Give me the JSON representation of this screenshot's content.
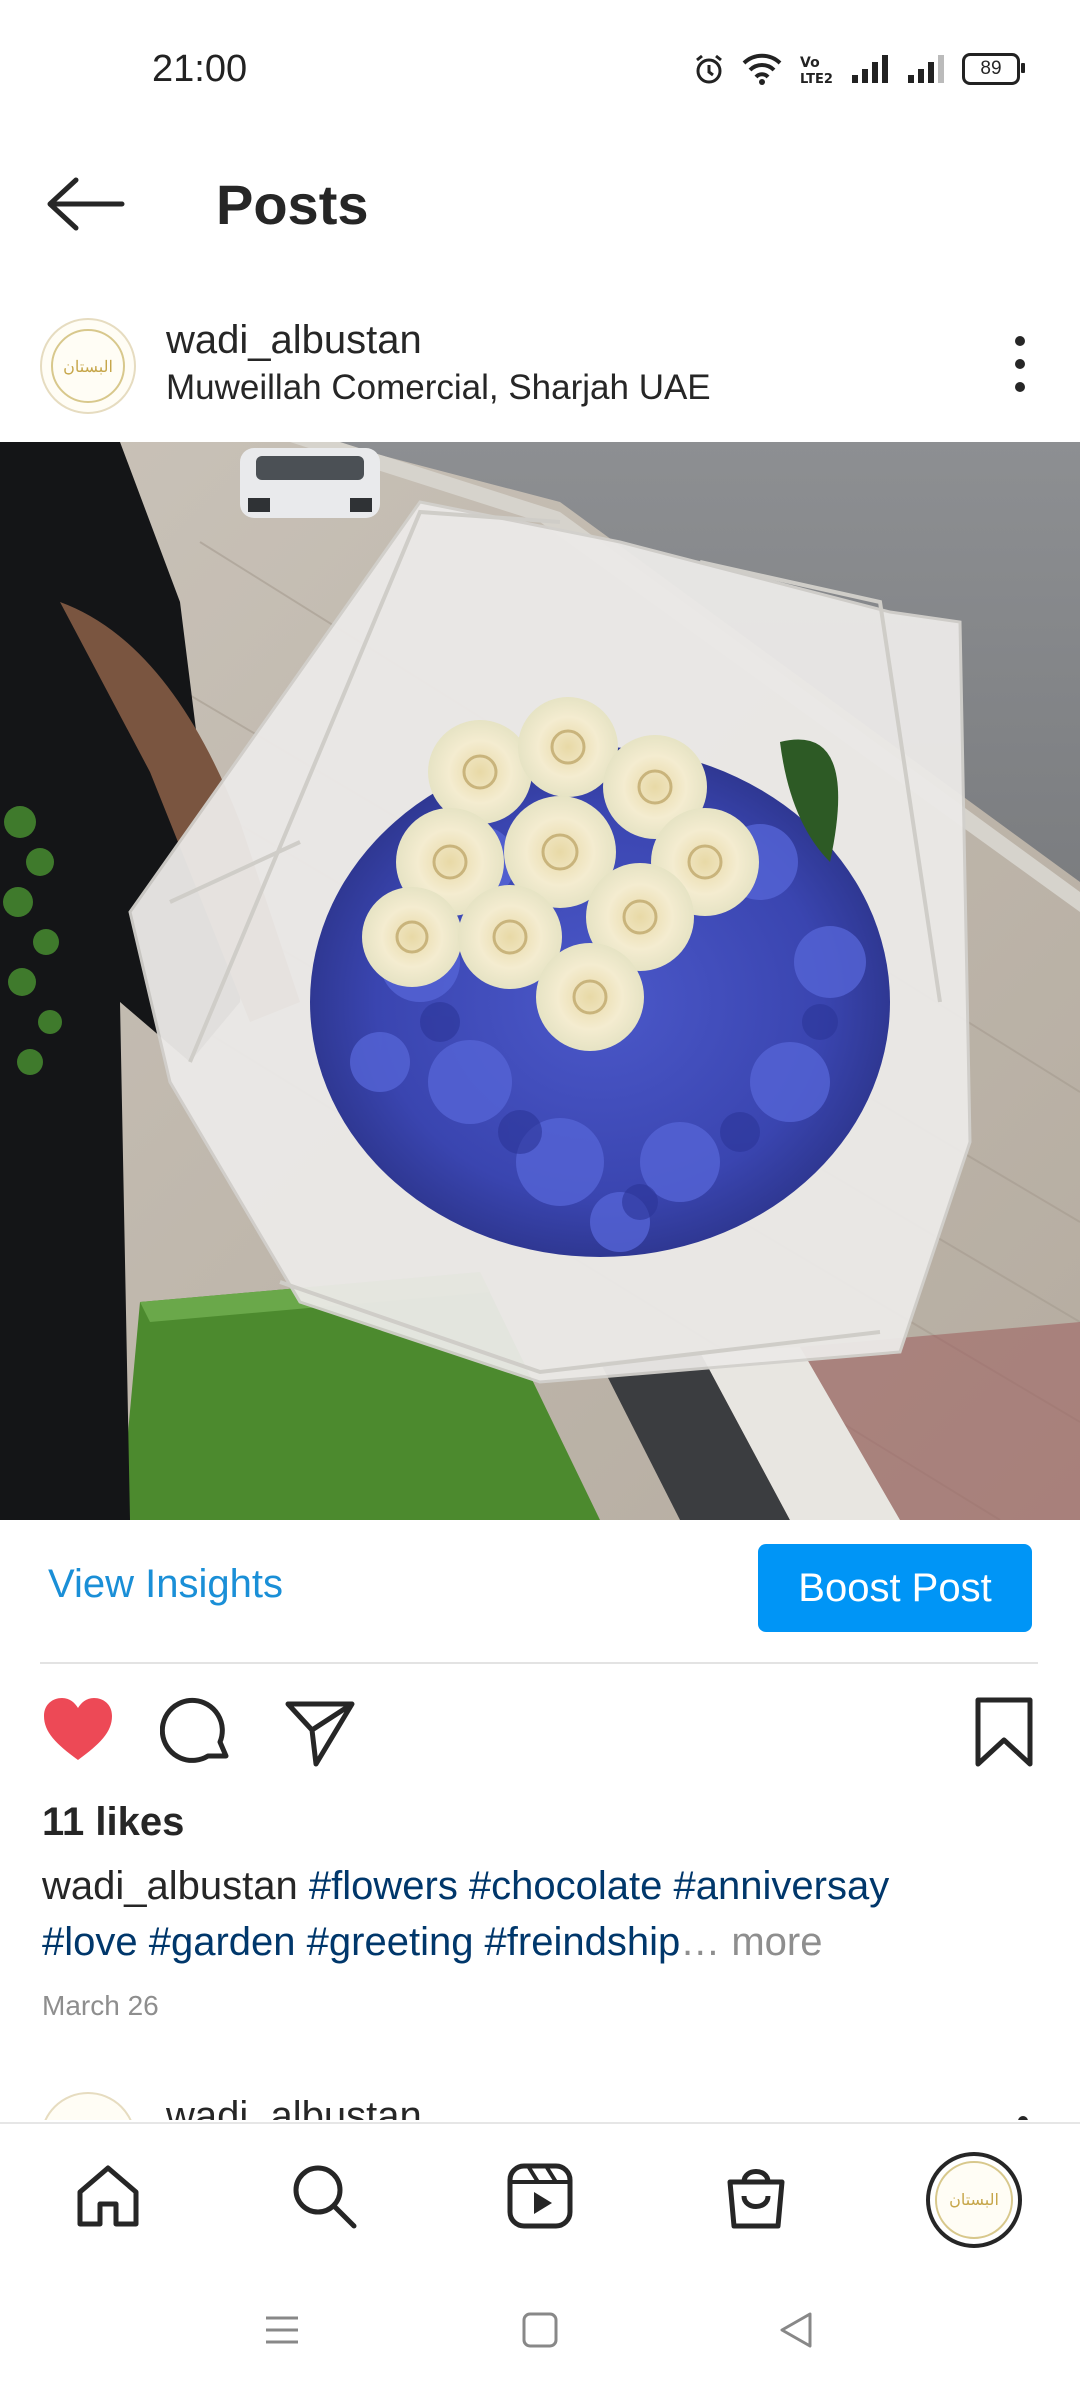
{
  "status_bar": {
    "time": "21:00",
    "battery": "89",
    "icons": [
      "alarm-icon",
      "wifi-icon",
      "volte-icon",
      "signal-icon",
      "signal-icon-2",
      "battery-icon"
    ]
  },
  "header": {
    "title": "Posts",
    "back_icon": "arrow-left-icon"
  },
  "post": {
    "username": "wadi_albustan",
    "location": "Muweillah Comercial, Sharjah UAE",
    "avatar_text": "البستان",
    "view_insights": "View Insights",
    "boost_post": "Boost Post",
    "likes": "11 likes",
    "caption_username": "wadi_albustan",
    "hashtags_line1": "#flowers #chocolate #anniversay",
    "hashtags_line2": "#love #garden #greeting #freindship",
    "more_label": "… more",
    "date": "March 26",
    "liked": true,
    "like_color": "#ed4956"
  },
  "next_post": {
    "username": "wadi_albustan"
  },
  "bottom_nav": {
    "items": [
      "home-icon",
      "search-icon",
      "reels-icon",
      "shop-icon",
      "profile-avatar"
    ]
  },
  "system_nav": {
    "items": [
      "menu-icon",
      "home-square-icon",
      "back-triangle-icon"
    ]
  },
  "colors": {
    "accent": "#0095f6",
    "link": "#1a8fd7",
    "hashtag": "#00376b"
  }
}
